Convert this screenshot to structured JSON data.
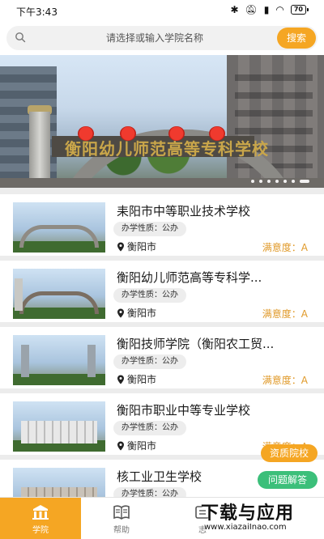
{
  "status_bar": {
    "time": "下午3:43",
    "battery": "70",
    "icons": [
      "bluetooth-icon",
      "mute-icon",
      "wifi-icon",
      "battery-icon"
    ]
  },
  "search": {
    "placeholder": "请选择或输入学院名称",
    "button_label": "搜索",
    "accent_color": "#f5a623"
  },
  "banner": {
    "sign_text": "衡阳幼儿师范高等专科学校",
    "slides_total": 7,
    "active_slide": 1
  },
  "schools": [
    {
      "name": "耒阳市中等职业技术学校",
      "nature": "办学性质：公办",
      "city": "衡阳市",
      "satisfaction": "满意度：A"
    },
    {
      "name": "衡阳幼儿师范高等专科学...",
      "nature": "办学性质：公办",
      "city": "衡阳市",
      "satisfaction": "满意度：A"
    },
    {
      "name": "衡阳技师学院（衡阳农工贸...",
      "nature": "办学性质：公办",
      "city": "衡阳市",
      "satisfaction": "满意度：A"
    },
    {
      "name": "衡阳市职业中等专业学校",
      "nature": "办学性质：公办",
      "city": "衡阳市",
      "satisfaction": "满意度：A"
    },
    {
      "name": "核工业卫生学校",
      "nature": "办学性质：公办",
      "city": "",
      "satisfaction": ""
    }
  ],
  "floating": {
    "qualified_label": "资质院校",
    "qa_label": "问题解答"
  },
  "bottom_nav": [
    {
      "label": "学院",
      "icon": "school-icon",
      "active": true
    },
    {
      "label": "帮助",
      "icon": "book-icon",
      "active": false
    },
    {
      "label": "志",
      "icon": "volunteer-icon",
      "active": false
    }
  ],
  "watermark": {
    "main": "下载与应用",
    "sub": "www.xiazaiInao.com"
  }
}
